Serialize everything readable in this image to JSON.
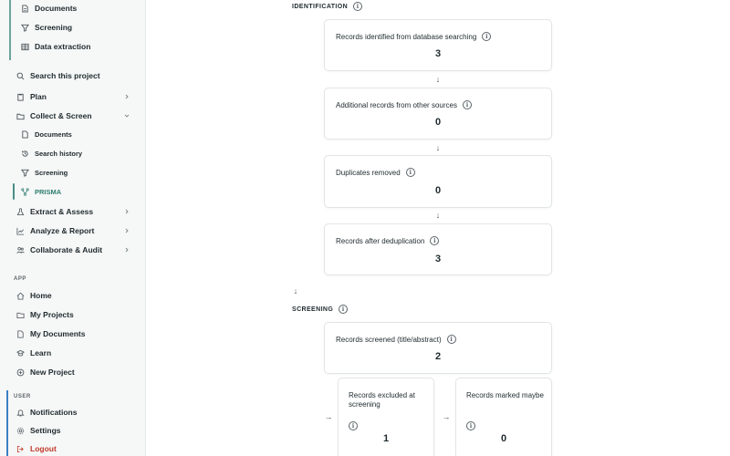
{
  "sidebar": {
    "top_items": [
      {
        "label": "Documents",
        "icon": "document-icon"
      },
      {
        "label": "Screening",
        "icon": "filter-icon"
      },
      {
        "label": "Data extraction",
        "icon": "table-icon"
      }
    ],
    "search_label": "Search this project",
    "plan_label": "Plan",
    "collect_label": "Collect & Screen",
    "collect_sub": [
      "Documents",
      "Search history",
      "Screening",
      "PRISMA"
    ],
    "extract_label": "Extract & Assess",
    "analyze_label": "Analyze & Report",
    "collaborate_label": "Collaborate & Audit",
    "app_section": "APP",
    "app_items": [
      "Home",
      "My Projects",
      "My Documents",
      "Learn",
      "New Project"
    ],
    "user_section": "USER",
    "notifications_label": "Notifications",
    "settings_label": "Settings",
    "logout_label": "Logout"
  },
  "identification": {
    "title": "IDENTIFICATION",
    "cards": [
      {
        "label": "Records identified from database searching",
        "value": "3"
      },
      {
        "label": "Additional records from other sources",
        "value": "0"
      },
      {
        "label": "Duplicates removed",
        "value": "0"
      },
      {
        "label": "Records after deduplication",
        "value": "3"
      }
    ]
  },
  "screening": {
    "title": "SCREENING",
    "screened": {
      "label": "Records screened (title/abstract)",
      "value": "2"
    },
    "excluded": {
      "label": "Records excluded at screening",
      "value": "1"
    },
    "maybe": {
      "label": "Records marked maybe",
      "value": "0"
    }
  },
  "colors": {
    "accent": "#2e7d6f",
    "logout": "#c0392b"
  }
}
